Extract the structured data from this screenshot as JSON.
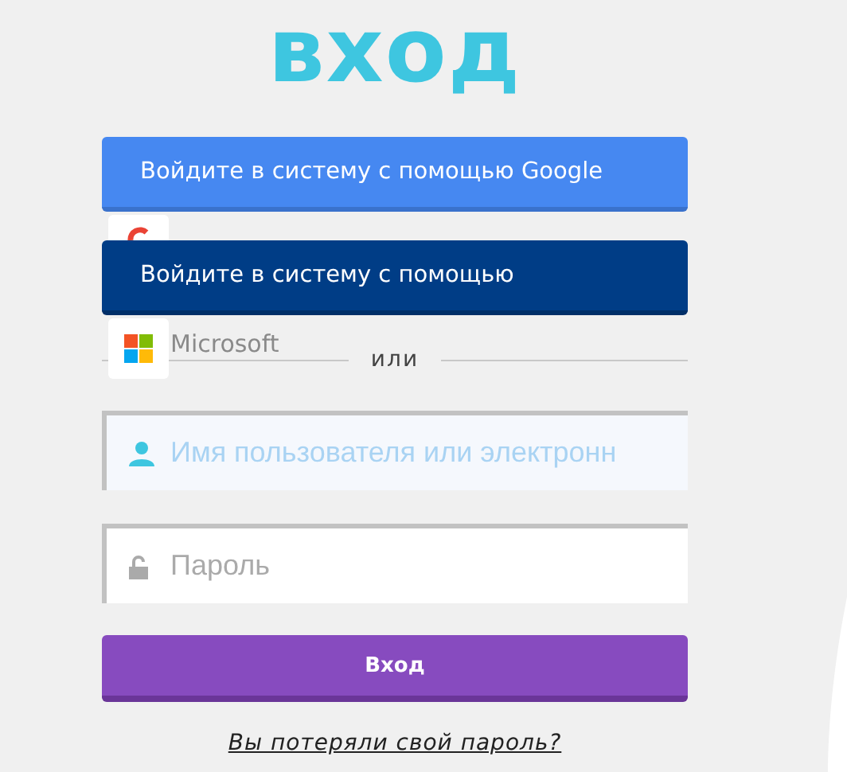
{
  "title": "вход",
  "social_buttons": [
    {
      "kind": "google",
      "label": "Войдите в систему с помощью Google"
    },
    {
      "kind": "microsoft",
      "label": "Войдите в систему с помощью",
      "tile_label": "Microsoft"
    }
  ],
  "divider": "или",
  "fields": [
    {
      "kind": "username",
      "placeholder": "Имя пользователя или электронн",
      "focused": true
    },
    {
      "kind": "password",
      "placeholder": "Пароль",
      "focused": false
    }
  ],
  "submit": "Вход",
  "forgot_link": "Вы потеряли свой пароль?"
}
